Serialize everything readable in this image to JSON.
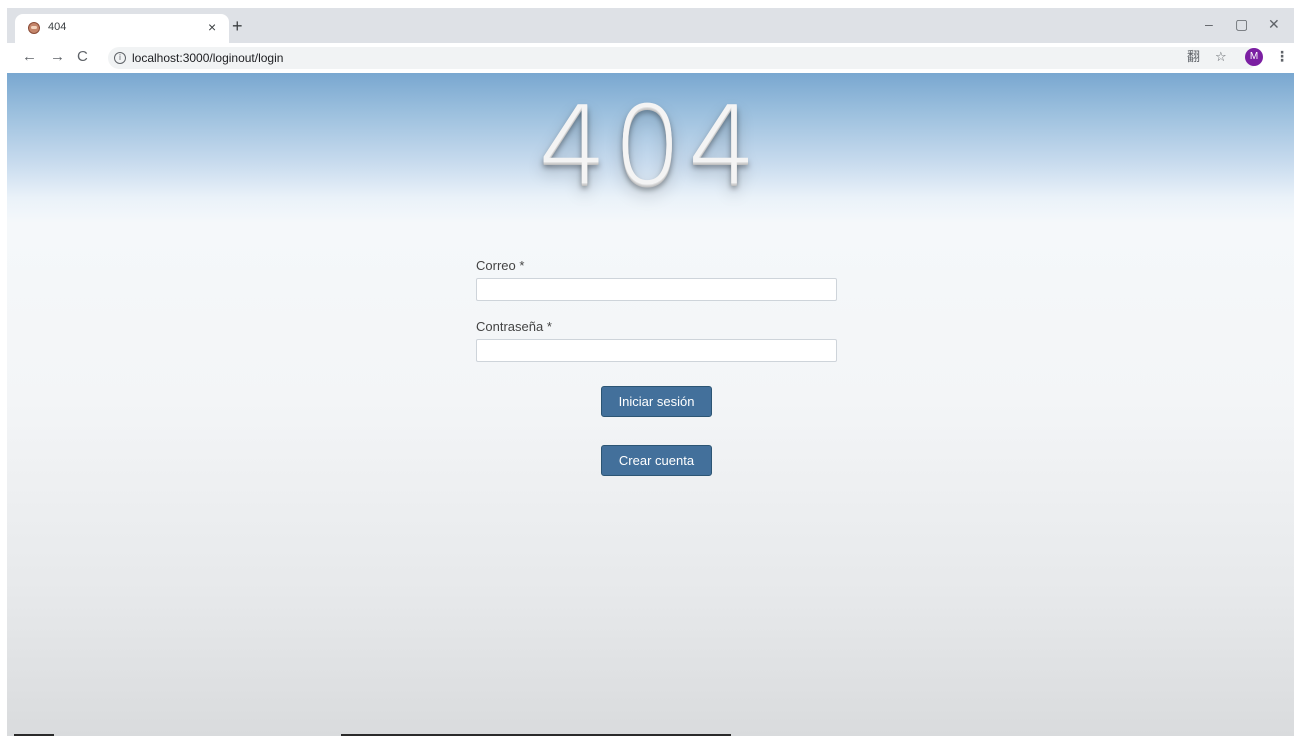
{
  "browser": {
    "tab": {
      "title": "404",
      "close_glyph": "×",
      "favicon": "tab-favicon-icon"
    },
    "new_tab_glyph": "+",
    "window_controls": {
      "minimize": "–",
      "restore": "▢",
      "close": "✕"
    },
    "nav": {
      "back": "←",
      "forward": "→",
      "reload": "C"
    },
    "url": "localhost:3000/loginout/login",
    "info_glyph": "i",
    "toolbar_icons": {
      "translate": "翻",
      "bookmark": "☆"
    },
    "profile_initial": "M",
    "menu_glyph": "⋮",
    "colors": {
      "frame": "#dee1e6",
      "avatar": "#7b1fa2"
    }
  },
  "page": {
    "hero_text": "404",
    "form": {
      "email_label": "Correo *",
      "email_value": "",
      "password_label": "Contraseña *",
      "password_value": ""
    },
    "login_button": "Iniciar sesión",
    "signup_button": "Crear cuenta",
    "colors": {
      "button": "#43709b",
      "header_top": "#79a7d0"
    }
  }
}
